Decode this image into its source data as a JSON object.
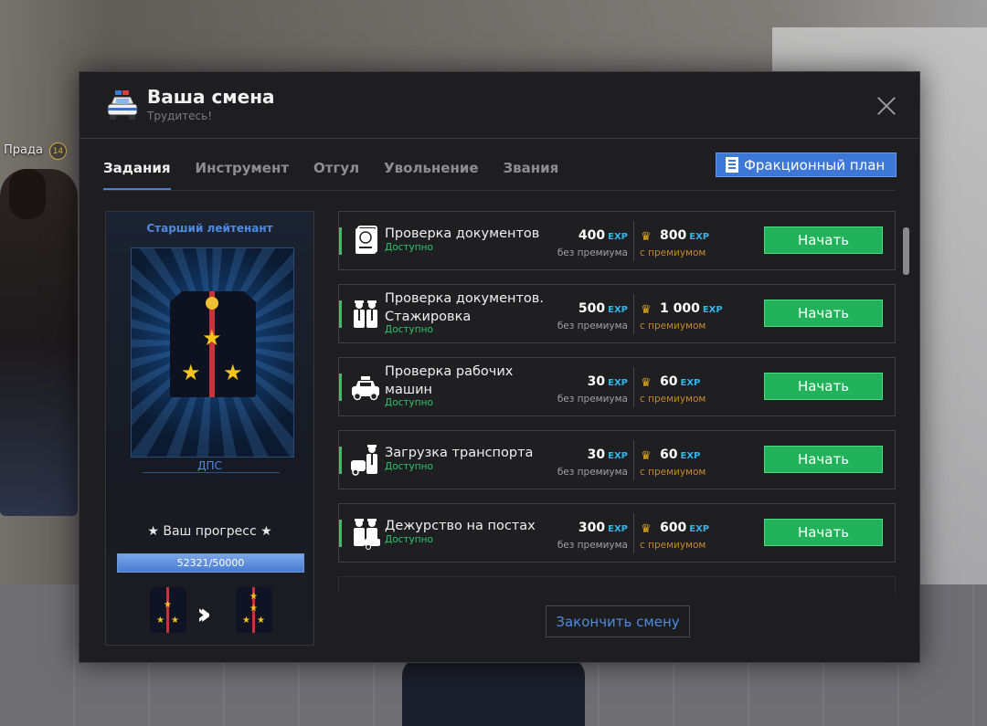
{
  "background": {
    "player_nick": "Прада",
    "player_level": "14"
  },
  "header": {
    "title": "Ваша смена",
    "subtitle": "Трудитесь!",
    "icon": "police-car-icon"
  },
  "tabs": [
    {
      "label": "Задания",
      "active": true
    },
    {
      "label": "Инструмент",
      "active": false
    },
    {
      "label": "Отгул",
      "active": false
    },
    {
      "label": "Увольнение",
      "active": false
    },
    {
      "label": "Звания",
      "active": false
    }
  ],
  "plan_button": {
    "label": "Фракционный план",
    "icon": "document-list-icon"
  },
  "rank": {
    "name": "Старший лейтенант",
    "department": "ДПС",
    "progress_label": "★ Ваш прогресс ★",
    "progress_text": "52321/50000",
    "progress_fraction": 1.0
  },
  "tasks": [
    {
      "name": "Проверка документов",
      "status": "Доступно",
      "exp_base": "400",
      "exp_premium": "800",
      "exp_tag": "EXP",
      "base_note": "без премиума",
      "premium_note": "с премиумом",
      "button": "Начать",
      "icon": "passport-icon"
    },
    {
      "name": "Проверка документов. Стажировка",
      "status": "Доступно",
      "exp_base": "500",
      "exp_premium": "1 000",
      "exp_tag": "EXP",
      "base_note": "без премиума",
      "premium_note": "с премиумом",
      "button": "Начать",
      "icon": "officers-icon"
    },
    {
      "name": "Проверка рабочих машин",
      "status": "Доступно",
      "exp_base": "30",
      "exp_premium": "60",
      "exp_tag": "EXP",
      "base_note": "без премиума",
      "premium_note": "с премиумом",
      "button": "Начать",
      "icon": "taxi-icon"
    },
    {
      "name": "Загрузка транспорта",
      "status": "Доступно",
      "exp_base": "30",
      "exp_premium": "60",
      "exp_tag": "EXP",
      "base_note": "без премиума",
      "premium_note": "с премиумом",
      "button": "Начать",
      "icon": "tow-officer-icon"
    },
    {
      "name": "Дежурство на постах",
      "status": "Доступно",
      "exp_base": "300",
      "exp_premium": "600",
      "exp_tag": "EXP",
      "base_note": "без премиума",
      "premium_note": "с премиумом",
      "button": "Начать",
      "icon": "patrol-post-icon"
    }
  ],
  "finish_button": "Закончить смену"
}
